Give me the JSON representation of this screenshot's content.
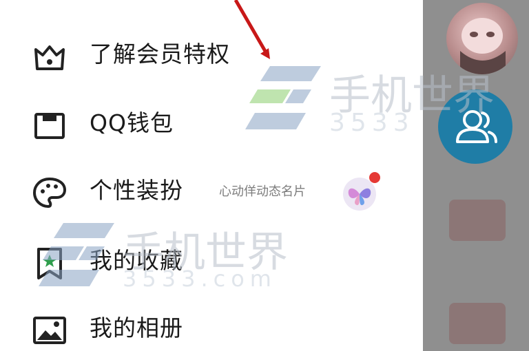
{
  "menu": {
    "items": [
      {
        "label": "了解会员特权",
        "icon": "crown-icon"
      },
      {
        "label": "QQ钱包",
        "icon": "wallet-icon"
      },
      {
        "label": "个性装扮",
        "icon": "palette-icon",
        "extra": "心动佯动态名片"
      },
      {
        "label": "我的收藏",
        "icon": "bookmark-star-icon"
      },
      {
        "label": "我的相册",
        "icon": "photo-album-icon"
      }
    ]
  },
  "watermark": {
    "title": "手机世界",
    "subtitle_short": "3533",
    "subtitle_full": "3533.com"
  },
  "colors": {
    "accent_blue": "#1f7da6",
    "arrow_red": "#c81818",
    "badge_red": "#e53935"
  }
}
